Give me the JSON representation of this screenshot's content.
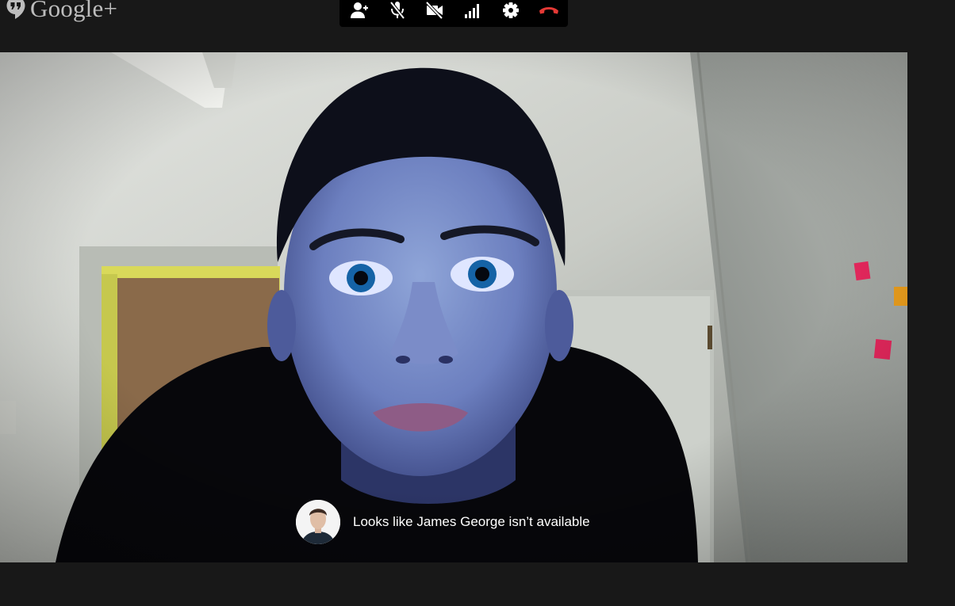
{
  "app": {
    "logo_text": "Google+",
    "logo_icon": "hangouts-quote-icon"
  },
  "toolbar": {
    "buttons": [
      {
        "name": "invite-people-button",
        "icon": "person-add-icon"
      },
      {
        "name": "mute-mic-button",
        "icon": "mic-off-icon"
      },
      {
        "name": "turn-off-camera-button",
        "icon": "videocam-off-icon"
      },
      {
        "name": "bandwidth-button",
        "icon": "signal-bars-icon"
      },
      {
        "name": "settings-button",
        "icon": "gear-icon"
      },
      {
        "name": "hang-up-button",
        "icon": "phone-hangup-icon"
      }
    ],
    "hangup_color": "#e53935"
  },
  "video": {
    "feed": "self-view"
  },
  "notification": {
    "message": "Looks like James George isn’t available"
  }
}
